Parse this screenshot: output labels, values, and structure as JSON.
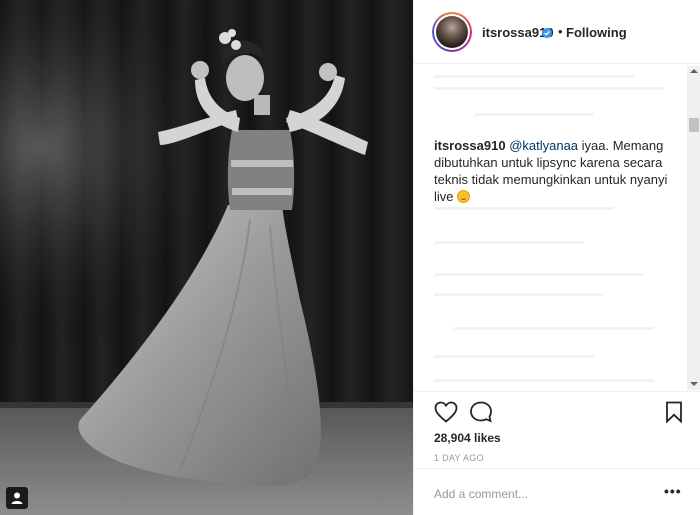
{
  "post": {
    "username": "itsrossa910",
    "separator": "•",
    "follow_status": "Following",
    "verified_icon": "verified-badge-icon",
    "accent_color": "#3897f0"
  },
  "comment": {
    "username": "itsrossa910",
    "mention": "@katlyanaa",
    "text": " iyaa. Memang dibutuhkan untuk lipsync karena secara teknis tidak memungkinkan untuk nyanyi live ",
    "emoji_icon": "smiling-face-icon"
  },
  "actions": {
    "like_icon": "heart-icon",
    "comment_icon": "comment-bubble-icon",
    "save_icon": "bookmark-icon"
  },
  "likes": "28,904 likes",
  "timestamp": "1 DAY AGO",
  "add_comment": {
    "placeholder": "Add a comment...",
    "more_label": "•••"
  }
}
